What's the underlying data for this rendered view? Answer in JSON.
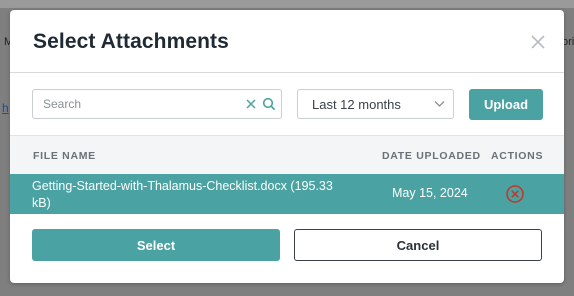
{
  "background": {
    "left_fragment": "M",
    "right_fragment": "ori",
    "link_fragment": "h"
  },
  "modal": {
    "title": "Select Attachments"
  },
  "toolbar": {
    "search_placeholder": "Search",
    "date_filter": "Last 12 months",
    "upload_label": "Upload"
  },
  "table": {
    "columns": [
      "FILE NAME",
      "DATE UPLOADED",
      "ACTIONS"
    ],
    "rows": [
      {
        "file_name": "Getting-Started-with-Thalamus-Checklist.docx (195.33 kB)",
        "date_uploaded": "May 15, 2024",
        "selected": true
      }
    ]
  },
  "footer": {
    "select_label": "Select",
    "cancel_label": "Cancel"
  },
  "colors": {
    "accent": "#4aa3a2",
    "remove_icon": "#c0392b",
    "title": "#1f2a33"
  },
  "icons": {
    "close": "close-icon",
    "clear": "clear-icon",
    "search": "search-icon",
    "dropdown": "chevron-down-icon",
    "remove": "remove-circle-icon"
  }
}
